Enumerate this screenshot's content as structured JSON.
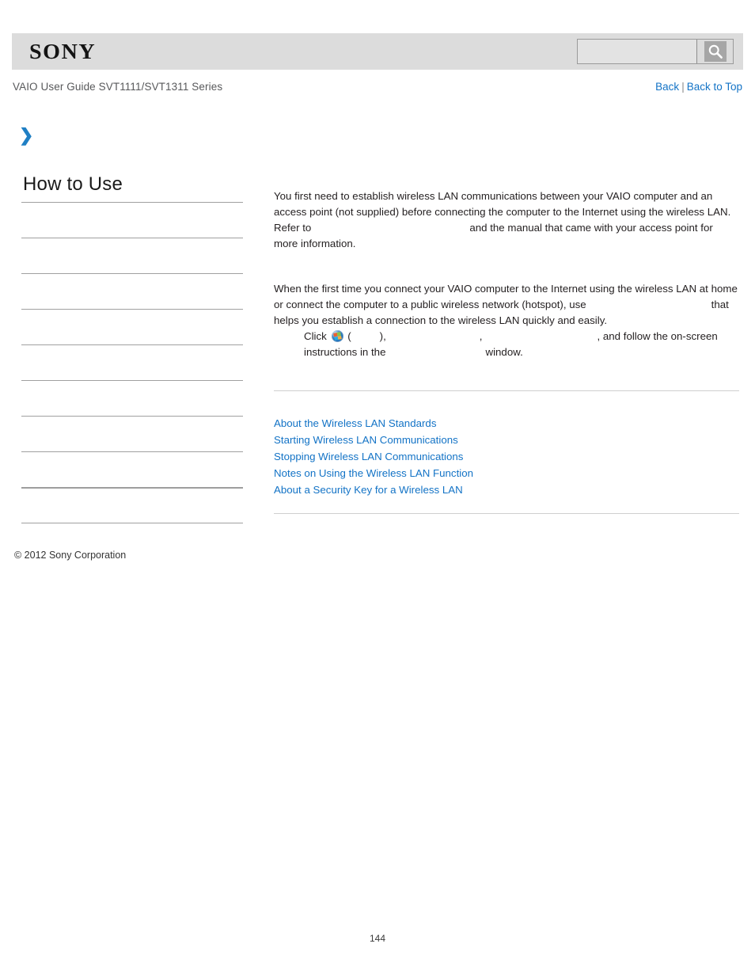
{
  "header": {
    "logo_text": "SONY",
    "search": {
      "value": "",
      "placeholder": "",
      "button_icon": "search-icon"
    }
  },
  "nav": {
    "doc_title": "VAIO User Guide SVT1111/SVT1311 Series",
    "back_label": "Back",
    "separator": "|",
    "back_to_top_label": "Back to Top"
  },
  "breadcrumb": {
    "arrow_glyph": "❯"
  },
  "sidebar": {
    "heading": "How to Use",
    "items": [
      {
        "label": ""
      },
      {
        "label": ""
      },
      {
        "label": ""
      },
      {
        "label": ""
      },
      {
        "label": ""
      },
      {
        "label": ""
      },
      {
        "label": ""
      },
      {
        "label": ""
      },
      {
        "label": ""
      },
      {
        "label": ""
      }
    ]
  },
  "content": {
    "paragraph1": {
      "part1": "You first need to establish wireless LAN communications between your VAIO computer and an access point (not supplied) before connecting the computer to the Internet using the wireless LAN. Refer to",
      "part2": "and the manual that came with your access point for more information."
    },
    "paragraph2": {
      "part1": "When the first time you connect your VAIO computer to the Internet using the wireless LAN at home or connect the computer to a public wireless network (hotspot), use",
      "part2": "that helps you establish a connection to the wireless LAN quickly and easily.",
      "click_label": "Click",
      "open_paren": "(",
      "close_paren": "),",
      "comma": ",",
      "part3": ", and follow the on-screen",
      "part4": "instructions in the",
      "part5": "window.",
      "start_icon": "windows-start-orb-icon"
    },
    "related_links": [
      "About the Wireless LAN Standards",
      "Starting Wireless LAN Communications",
      "Stopping Wireless LAN Communications",
      "Notes on Using the Wireless LAN Function",
      "About a Security Key for a Wireless LAN"
    ]
  },
  "footer": {
    "copyright": "© 2012 Sony Corporation",
    "page_number": "144"
  },
  "colors": {
    "link_blue": "#1373c6",
    "header_gray": "#dcdcdc",
    "arrow_blue": "#1f7fc4"
  }
}
